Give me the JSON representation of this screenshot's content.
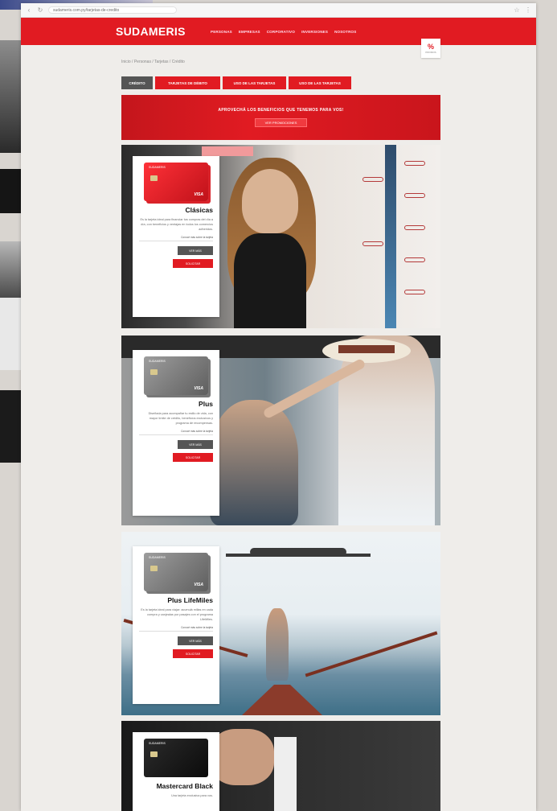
{
  "browser": {
    "url": "sudameris.com.py/tarjetas-de-credito"
  },
  "site": {
    "logo": "SUDAMERIS",
    "menu": [
      "PERSONAS",
      "EMPRESAS",
      "CORPORATIVO",
      "INVERSIONES",
      "NOSOTROS"
    ],
    "badge_mark": "%",
    "badge_text": "PROMOS"
  },
  "breadcrumb": "Inicio / Personas / Tarjetas / Crédito",
  "tabs": [
    "CRÉDITO",
    "TARJETAS DE DÉBITO",
    "USO DE LAS TARJETAS",
    "USO DE LAS TARJETAS"
  ],
  "promo": {
    "title": "APROVECHÁ LOS BENEFICIOS QUE TENEMOS PARA VOS!",
    "button": "VER PROMOCIONES"
  },
  "products": [
    {
      "name": "Clásicas",
      "description": "Es la tarjeta ideal para financiar tus compras del día a día, con beneficios y ventajas en todos los comercios adheridos.",
      "link": "Conocé más sobre la tarjeta",
      "more": "VER MÁS",
      "apply": "SOLICITAR",
      "card_bank": "SUDAMERIS",
      "card_brand": "VISA"
    },
    {
      "name": "Plus",
      "description": "Diseñada para acompañar tu estilo de vida, con mayor límite de crédito, beneficios exclusivos y programa de recompensas.",
      "link": "Conocé más sobre la tarjeta",
      "more": "VER MÁS",
      "apply": "SOLICITAR",
      "card_bank": "SUDAMERIS",
      "card_brand": "VISA"
    },
    {
      "name": "Plus LifeMiles",
      "description": "Es la tarjeta ideal para viajar: acumulá millas en cada compra y canjealas por pasajes con el programa LifeMiles.",
      "link": "Conocé más sobre la tarjeta",
      "more": "VER MÁS",
      "apply": "SOLICITAR",
      "card_bank": "SUDAMERIS",
      "card_brand": "VISA"
    },
    {
      "name": "Mastercard Black",
      "description": "Una tarjeta exclusiva para vos.",
      "card_bank": "SUDAMERIS",
      "card_brand": ""
    }
  ]
}
